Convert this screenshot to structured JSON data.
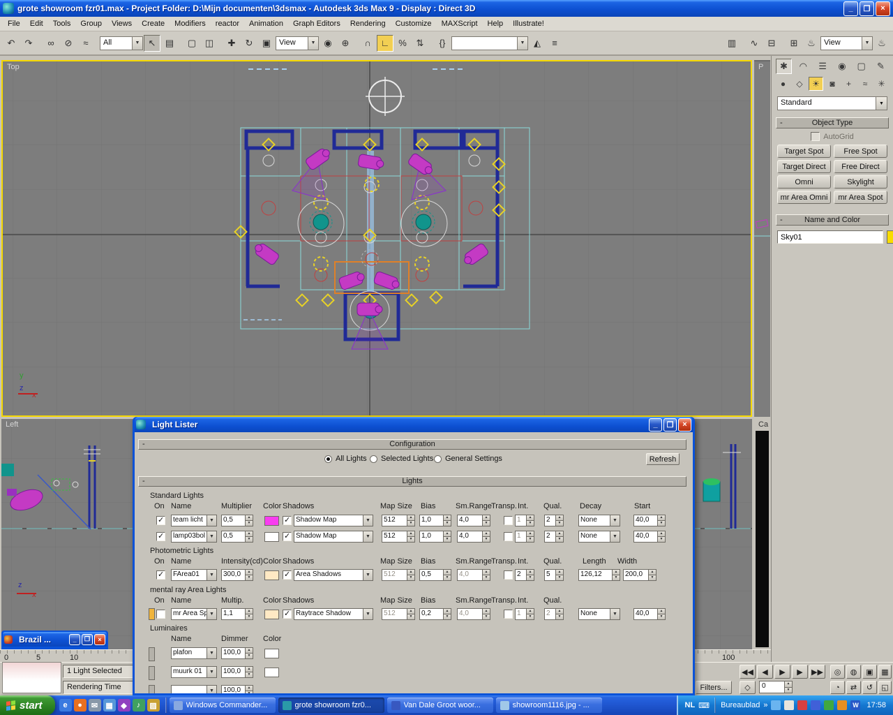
{
  "titlebar": {
    "title": "grote showroom fzr01.max    - Project Folder: D:\\Mijn documenten\\3dsmax    - Autodesk 3ds Max 9    - Display : Direct 3D"
  },
  "menubar": {
    "items": [
      "File",
      "Edit",
      "Tools",
      "Group",
      "Views",
      "Create",
      "Modifiers",
      "reactor",
      "Animation",
      "Graph Editors",
      "Rendering",
      "Customize",
      "MAXScript",
      "Help",
      "Illustrate!"
    ]
  },
  "toolbar": {
    "selection_filter": "All",
    "ref_coord": "View",
    "render_type": "View",
    "named_selection": "",
    "icons": [
      {
        "name": "undo",
        "glyph": "↶"
      },
      {
        "name": "redo",
        "glyph": "↷"
      },
      {
        "name": "select-and-link",
        "glyph": "∞"
      },
      {
        "name": "unlink-selection",
        "glyph": "⊘"
      },
      {
        "name": "bind-to-space-warp",
        "glyph": "≈"
      },
      {
        "name": "select-object",
        "glyph": "↖"
      },
      {
        "name": "select-by-name",
        "glyph": "▤"
      },
      {
        "name": "rectangular-selection-region",
        "glyph": "▢"
      },
      {
        "name": "window-crossing-toggle",
        "glyph": "◫"
      },
      {
        "name": "select-and-move",
        "glyph": "✚"
      },
      {
        "name": "select-and-rotate",
        "glyph": "↻"
      },
      {
        "name": "select-and-scale",
        "glyph": "▣"
      },
      {
        "name": "use-pivot-point-center",
        "glyph": "◉"
      },
      {
        "name": "select-and-manipulate",
        "glyph": "⊕"
      },
      {
        "name": "snaps-toggle",
        "glyph": "∩"
      },
      {
        "name": "angle-snap-toggle",
        "glyph": "∟"
      },
      {
        "name": "percent-snap-toggle",
        "glyph": "%"
      },
      {
        "name": "spinner-snap-toggle",
        "glyph": "⇅"
      },
      {
        "name": "edit-named-selection-sets",
        "glyph": "{}"
      },
      {
        "name": "mirror",
        "glyph": "◭"
      },
      {
        "name": "align",
        "glyph": "≡"
      },
      {
        "name": "layer-manager",
        "glyph": "▥"
      },
      {
        "name": "curve-editor",
        "glyph": "∿"
      },
      {
        "name": "schematic-view",
        "glyph": "⊟"
      },
      {
        "name": "material-editor",
        "glyph": "⊞"
      },
      {
        "name": "render-scene",
        "glyph": "♨"
      },
      {
        "name": "quick-render",
        "glyph": "♨"
      }
    ]
  },
  "viewports": {
    "top": "Top",
    "left": "Left",
    "p": "P",
    "ca": "Ca",
    "axis_x": "x",
    "axis_y": "y",
    "axis_z": "z"
  },
  "command_panel": {
    "tabs": [
      {
        "name": "create",
        "glyph": "✱"
      },
      {
        "name": "modify",
        "glyph": "◠"
      },
      {
        "name": "hierarchy",
        "glyph": "☰"
      },
      {
        "name": "motion",
        "glyph": "◉"
      },
      {
        "name": "display",
        "glyph": "▢"
      },
      {
        "name": "utilities",
        "glyph": "✎"
      }
    ],
    "categories": [
      {
        "name": "geometry",
        "glyph": "●"
      },
      {
        "name": "shapes",
        "glyph": "◇"
      },
      {
        "name": "lights",
        "glyph": "☀"
      },
      {
        "name": "cameras",
        "glyph": "◙"
      },
      {
        "name": "helpers",
        "glyph": "+"
      },
      {
        "name": "space-warps",
        "glyph": "≈"
      },
      {
        "name": "systems",
        "glyph": "✳"
      }
    ],
    "mode": "Standard",
    "rollout_object_type": "Object Type",
    "autogrid": "AutoGrid",
    "buttons": [
      "Target Spot",
      "Free Spot",
      "Target Direct",
      "Free Direct",
      "Omni",
      "Skylight",
      "mr Area Omni",
      "mr Area Spot"
    ],
    "rollout_name_color": "Name and Color",
    "object_name": "Sky01",
    "object_color": "#f8dc00"
  },
  "timeline": {
    "labels": [
      "0",
      "5",
      "10",
      "100"
    ]
  },
  "status": {
    "selected": "1 Light Selected",
    "render_time": "Rendering Time",
    "filters": "Filters...",
    "frame": "0"
  },
  "playback": [
    {
      "name": "go-to-start",
      "glyph": "◀◀"
    },
    {
      "name": "previous-frame",
      "glyph": "◀"
    },
    {
      "name": "play",
      "glyph": "▶"
    },
    {
      "name": "next-frame",
      "glyph": "▶"
    },
    {
      "name": "go-to-end",
      "glyph": "▶▶"
    }
  ],
  "nav": [
    {
      "name": "zoom",
      "glyph": "◎"
    },
    {
      "name": "zoom-all",
      "glyph": "◍"
    },
    {
      "name": "zoom-extents",
      "glyph": "▣"
    },
    {
      "name": "zoom-extents-all",
      "glyph": "▦"
    },
    {
      "name": "field-of-view",
      "glyph": "◔"
    },
    {
      "name": "pan",
      "glyph": "⇄"
    },
    {
      "name": "arc-rotate",
      "glyph": "↺"
    },
    {
      "name": "min-max-toggle",
      "glyph": "◱"
    }
  ],
  "light_lister": {
    "title": "Light Lister",
    "config": {
      "title": "Configuration",
      "all_lights": "All Lights",
      "selected_lights": "Selected Lights",
      "general_settings": "General Settings",
      "refresh": "Refresh"
    },
    "lights_title": "Lights",
    "standard": {
      "label": "Standard Lights",
      "headers": {
        "on": "On",
        "name": "Name",
        "multiplier": "Multiplier",
        "color": "Color",
        "shadows": "Shadows",
        "map_size": "Map Size",
        "bias": "Bias",
        "sm_range": "Sm.Range",
        "transp": "Transp.",
        "int": "Int.",
        "qual": "Qual.",
        "decay": "Decay",
        "start": "Start"
      },
      "rows": [
        {
          "name": "team licht",
          "multiplier": "0,5",
          "color": "#f83df0",
          "shadow_type": "Shadow Map",
          "map_size": "512",
          "bias": "1,0",
          "sm_range": "4,0",
          "int": "1",
          "qual": "2",
          "decay": "None",
          "start": "40,0"
        },
        {
          "name": "lamp03bol",
          "multiplier": "0,5",
          "color": "#ffffff",
          "shadow_type": "Shadow Map",
          "map_size": "512",
          "bias": "1,0",
          "sm_range": "4,0",
          "int": "1",
          "qual": "2",
          "decay": "None",
          "start": "40,0"
        }
      ]
    },
    "photometric": {
      "label": "Photometric Lights",
      "headers": {
        "on": "On",
        "name": "Name",
        "intensity": "Intensity(cd)",
        "color": "Color",
        "shadows": "Shadows",
        "map_size": "Map Size",
        "bias": "Bias",
        "sm_range": "Sm.Range",
        "transp": "Transp.",
        "int": "Int.",
        "qual": "Qual.",
        "length": "Length",
        "width": "Width"
      },
      "rows": [
        {
          "name": "FArea01",
          "intensity": "300,0",
          "color": "#ffe9c4",
          "shadow_type": "Area Shadows",
          "map_size": "512",
          "bias": "0,5",
          "sm_range": "4,0",
          "int": "2",
          "qual": "5",
          "length": "126,12",
          "width": "200,0"
        }
      ]
    },
    "mental_ray": {
      "label": "mental ray Area Lights",
      "headers": {
        "on": "On",
        "name": "Name",
        "multip": "Multip.",
        "color": "Color",
        "shadows": "Shadows",
        "map_size": "Map Size",
        "bias": "Bias",
        "sm_range": "Sm.Range",
        "transp": "Transp.",
        "int": "Int.",
        "qual": "Qual."
      },
      "rows": [
        {
          "name": "mr Area Spot",
          "multip": "1,1",
          "color": "#ffe9c4",
          "shadow_type": "Raytrace Shadow",
          "map_size": "512",
          "bias": "0,2",
          "sm_range": "4,0",
          "int": "1",
          "qual": "2",
          "decay": "None",
          "start": "40,0"
        }
      ]
    },
    "luminaires": {
      "label": "Luminaires",
      "headers": {
        "name": "Name",
        "dimmer": "Dimmer",
        "color": "Color"
      },
      "rows": [
        {
          "name": "plafon",
          "dimmer": "100,0",
          "color": "#ffffff"
        },
        {
          "name": "muurk 01",
          "dimmer": "100,0",
          "color": "#ffffff"
        },
        {
          "name": "",
          "dimmer": "100,0",
          "color": "#ffff ff"
        }
      ]
    }
  },
  "brazil": {
    "title": "Brazil ..."
  },
  "taskbar": {
    "start": "start",
    "quicklaunch": [
      {
        "name": "internet-explorer",
        "glyph": "e",
        "color": "#3a7ae0"
      },
      {
        "name": "browser",
        "glyph": "●",
        "color": "#e87020"
      },
      {
        "name": "mail",
        "glyph": "✉",
        "color": "#8898a8"
      },
      {
        "name": "show-desktop",
        "glyph": "▦",
        "color": "#5898d8"
      },
      {
        "name": "media-player",
        "glyph": "◆",
        "color": "#9040c0"
      },
      {
        "name": "music",
        "glyph": "♪",
        "color": "#40a060"
      },
      {
        "name": "folder",
        "glyph": "▨",
        "color": "#c8a030"
      }
    ],
    "tasks": [
      {
        "label": "Windows Commander...",
        "icon_color": "#88a8e0"
      },
      {
        "label": "grote showroom fzr0...",
        "icon_color": "#2a9aa8"
      },
      {
        "label": "Van Dale Groot woor...",
        "icon_color": "#3858c0"
      },
      {
        "label": "showroom1116.jpg - ...",
        "icon_color": "#a0c8e8"
      }
    ],
    "tray": {
      "lang": "NL",
      "keyboard": "⌨",
      "toolbar_label": "Bureaublad",
      "chevron": "»",
      "clock": "17:58",
      "icons": [
        {
          "name": "tray-icon-1",
          "glyph": "",
          "color": "#6ab4f0"
        },
        {
          "name": "tray-icon-2",
          "glyph": "",
          "color": "#e8e4dc"
        },
        {
          "name": "tray-icon-3",
          "glyph": "",
          "color": "#d84040"
        },
        {
          "name": "tray-icon-4",
          "glyph": "",
          "color": "#4060d8"
        },
        {
          "name": "tray-icon-5",
          "glyph": "",
          "color": "#40a840"
        },
        {
          "name": "tray-icon-6",
          "glyph": "",
          "color": "#e89020"
        },
        {
          "name": "tray-icon-7",
          "glyph": "W",
          "color": "#2858c8"
        }
      ]
    }
  }
}
